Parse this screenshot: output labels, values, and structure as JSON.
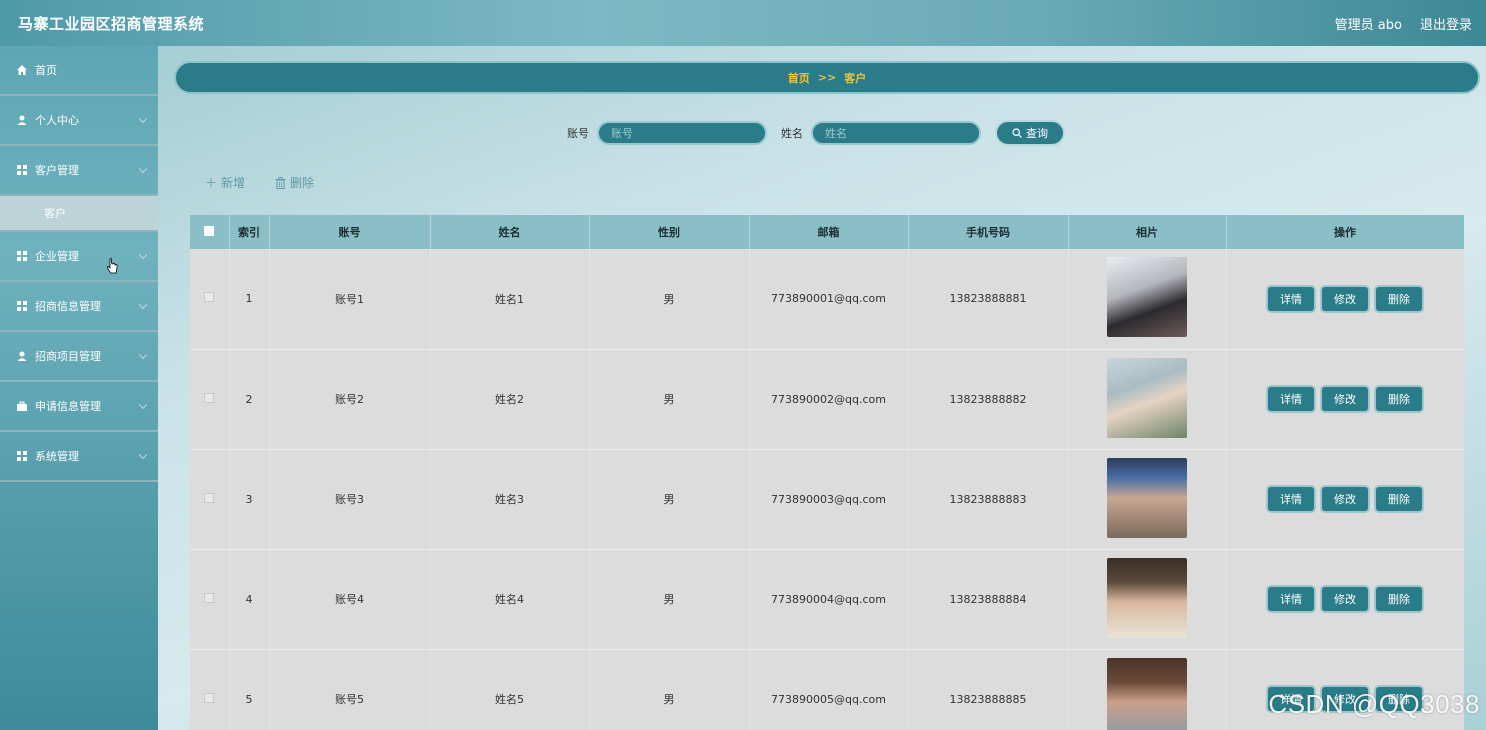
{
  "header": {
    "title": "马寨工业园区招商管理系统",
    "user_label": "管理员 abo",
    "logout_label": "退出登录"
  },
  "sidebar": {
    "items": [
      {
        "label": "首页",
        "icon": "home-icon"
      },
      {
        "label": "个人中心",
        "icon": "user-icon"
      },
      {
        "label": "客户管理",
        "icon": "grid-icon"
      },
      {
        "label": "企业管理",
        "icon": "grid-icon"
      },
      {
        "label": "招商信息管理",
        "icon": "grid-icon"
      },
      {
        "label": "招商项目管理",
        "icon": "user-icon"
      },
      {
        "label": "申请信息管理",
        "icon": "briefcase-icon"
      },
      {
        "label": "系统管理",
        "icon": "grid-icon"
      }
    ],
    "sub_item": "客户"
  },
  "breadcrumb": {
    "home": "首页",
    "separator": ">>",
    "current": "客户"
  },
  "search": {
    "account_label": "账号",
    "account_placeholder": "账号",
    "name_label": "姓名",
    "name_placeholder": "姓名",
    "button_label": "查询"
  },
  "toolbar": {
    "add_label": "新增",
    "delete_label": "删除"
  },
  "table": {
    "columns": [
      "索引",
      "账号",
      "姓名",
      "性别",
      "邮箱",
      "手机号码",
      "相片",
      "操作"
    ],
    "rows": [
      {
        "index": "1",
        "account": "账号1",
        "name": "姓名1",
        "gender": "男",
        "email": "773890001@qq.com",
        "phone": "13823888881"
      },
      {
        "index": "2",
        "account": "账号2",
        "name": "姓名2",
        "gender": "男",
        "email": "773890002@qq.com",
        "phone": "13823888882"
      },
      {
        "index": "3",
        "account": "账号3",
        "name": "姓名3",
        "gender": "男",
        "email": "773890003@qq.com",
        "phone": "13823888883"
      },
      {
        "index": "4",
        "account": "账号4",
        "name": "姓名4",
        "gender": "男",
        "email": "773890004@qq.com",
        "phone": "13823888884"
      },
      {
        "index": "5",
        "account": "账号5",
        "name": "姓名5",
        "gender": "男",
        "email": "773890005@qq.com",
        "phone": "13823888885"
      }
    ],
    "row_actions": {
      "detail": "详情",
      "edit": "修改",
      "delete": "删除"
    }
  },
  "watermark": "CSDN @QQ3038",
  "colors": {
    "primary": "#2a7c88",
    "breadcrumb_text": "#f0c23a",
    "header_bg": "#8bbfc8"
  }
}
